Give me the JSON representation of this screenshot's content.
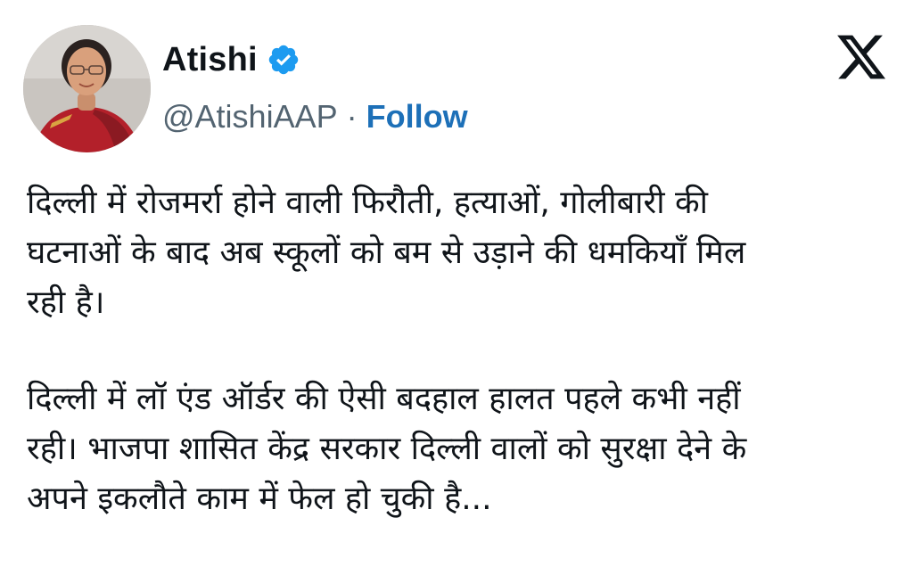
{
  "author": {
    "display_name": "Atishi",
    "handle": "@AtishiAAP",
    "separator": "·",
    "follow_label": "Follow",
    "verified_icon": "verified-badge-icon",
    "avatar_icon": "profile-photo"
  },
  "platform": {
    "logo_icon": "x-logo-icon"
  },
  "colors": {
    "verified": "#1d9bf0",
    "follow": "#1d70b8",
    "text": "#0f1419",
    "muted": "#536471"
  },
  "tweet": {
    "paragraphs": [
      "दिल्ली में रोजमर्रा होने वाली फिरौती, हत्याओं, गोलीबारी की\nघटनाओं के बाद अब स्कूलों को बम से उड़ाने की धमकियाँ मिल\nरही है।",
      "दिल्ली में लॉ एंड ऑर्डर की ऐसी बदहाल हालत पहले कभी नहीं\nरही। भाजपा शासित केंद्र सरकार दिल्ली वालों को सुरक्षा देने के\nअपने इकलौते काम में फेल हो चुकी है..."
    ]
  }
}
